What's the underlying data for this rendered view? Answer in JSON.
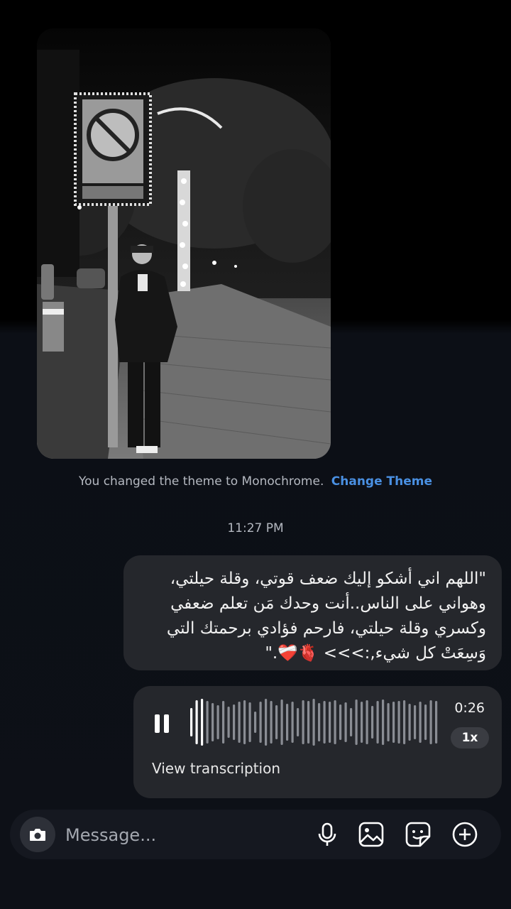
{
  "theme_notice": {
    "text": "You changed the theme to Monochrome.",
    "link": "Change Theme"
  },
  "timestamp": "11:27 PM",
  "message_text": "\"اللهم اني أشكو إليك ضعف قوتي، وقلة حيلتي، وهواني على الناس..أنت وحدك مَن تعلم ضعفي وكسري وقلة حيلتي، فارحم فؤادي برحمتك التي وَسِعَتْ كل شيء,:>>> 🫀❤️‍🩹.\"",
  "voice_message": {
    "duration": "0:26",
    "speed": "1x",
    "transcription_link": "View transcription"
  },
  "composer": {
    "placeholder": "Message..."
  },
  "icons": {
    "camera": "camera-icon",
    "microphone": "microphone-icon",
    "gallery": "gallery-icon",
    "sticker": "sticker-icon",
    "add": "plus-icon",
    "pause": "pause-icon"
  },
  "colors": {
    "link": "#4a90e2",
    "bubble": "#25272c",
    "background": "#0d1017"
  }
}
